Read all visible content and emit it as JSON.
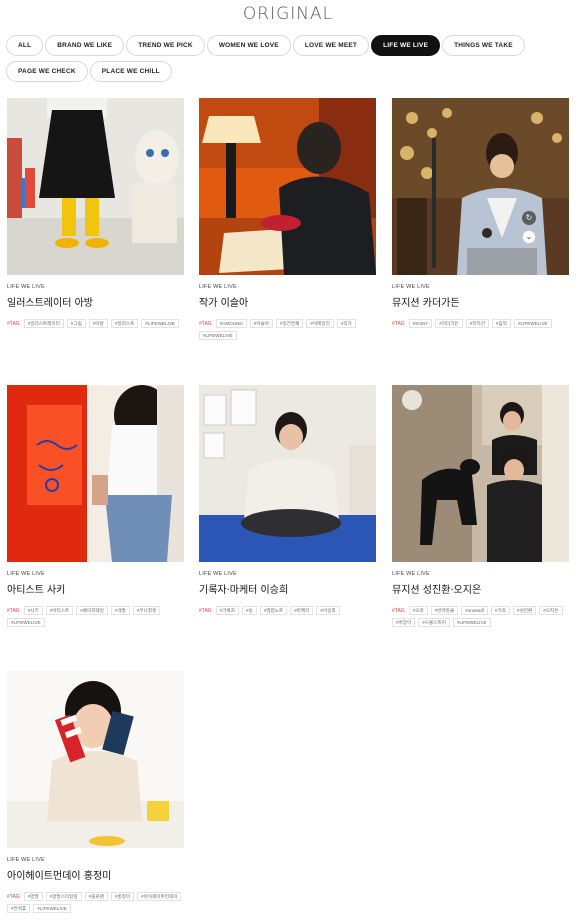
{
  "page": {
    "title": "ORIGINAL"
  },
  "filters": [
    {
      "label": "ALL",
      "active": false
    },
    {
      "label": "BRAND WE LIKE",
      "active": false
    },
    {
      "label": "TREND WE PICK",
      "active": false
    },
    {
      "label": "WOMEN WE LOVE",
      "active": false
    },
    {
      "label": "LOVE WE MEET",
      "active": false
    },
    {
      "label": "LIFE WE LIVE",
      "active": true
    },
    {
      "label": "THINGS WE TAKE",
      "active": false
    },
    {
      "label": "PAGE WE CHECK",
      "active": false
    },
    {
      "label": "PLACE WE CHILL",
      "active": false
    }
  ],
  "tag_label": "#TAG",
  "cards": [
    {
      "category": "LIFE WE LIVE",
      "title": "일러스트레이터 아방",
      "tags": [
        "#일러스트레이터",
        "#그림",
        "#아방",
        "#일러스트",
        "#LIFEWELIVE"
      ]
    },
    {
      "category": "LIFE WE LIVE",
      "title": "작가 이슬아",
      "tags": [
        "#AMOUND",
        "#이슬아",
        "#일간연재",
        "#이메일진",
        "#작가",
        "#LIFEWELIVE"
      ]
    },
    {
      "category": "LIFE WE LIVE",
      "title": "뮤지션 카더가든",
      "tags": [
        "#SONY",
        "#카더가든",
        "#뮤지션",
        "#음악",
        "#LIFEWELIVE"
      ]
    },
    {
      "category": "LIFE WE LIVE",
      "title": "아티스트 사키",
      "tags": [
        "#사키",
        "#아티스트",
        "#페이지렉일",
        "#개발",
        "#무나창홍",
        "#LIFEWELIVE"
      ]
    },
    {
      "category": "LIFE WE LIVE",
      "title": "기록자·마케터 이승희",
      "tags": [
        "#기록자",
        "#숭",
        "#영업노트",
        "#마케터",
        "#이승희"
      ]
    },
    {
      "category": "LIFE WE LIVE",
      "title": "뮤지션 성진환·오지은",
      "tags": [
        "#오마",
        "#반려동물",
        "#onestuff",
        "#가족",
        "#성진환",
        "#오지은",
        "#흑앙이",
        "#스몰스피커",
        "#LIFEWELIVE"
      ]
    },
    {
      "category": "LIFE WE LIVE",
      "title": "아이헤이트먼데이 홍정미",
      "tags": [
        "#양말",
        "#양말스타일링",
        "#블로랜",
        "#홍정미",
        "#아이헤이트먼데이",
        "#컨위휴",
        "#LIFEWELIVE"
      ]
    }
  ],
  "icons": {
    "scroll_top": "circular-arrow-icon",
    "scroll_down": "chevron-down-icon"
  }
}
